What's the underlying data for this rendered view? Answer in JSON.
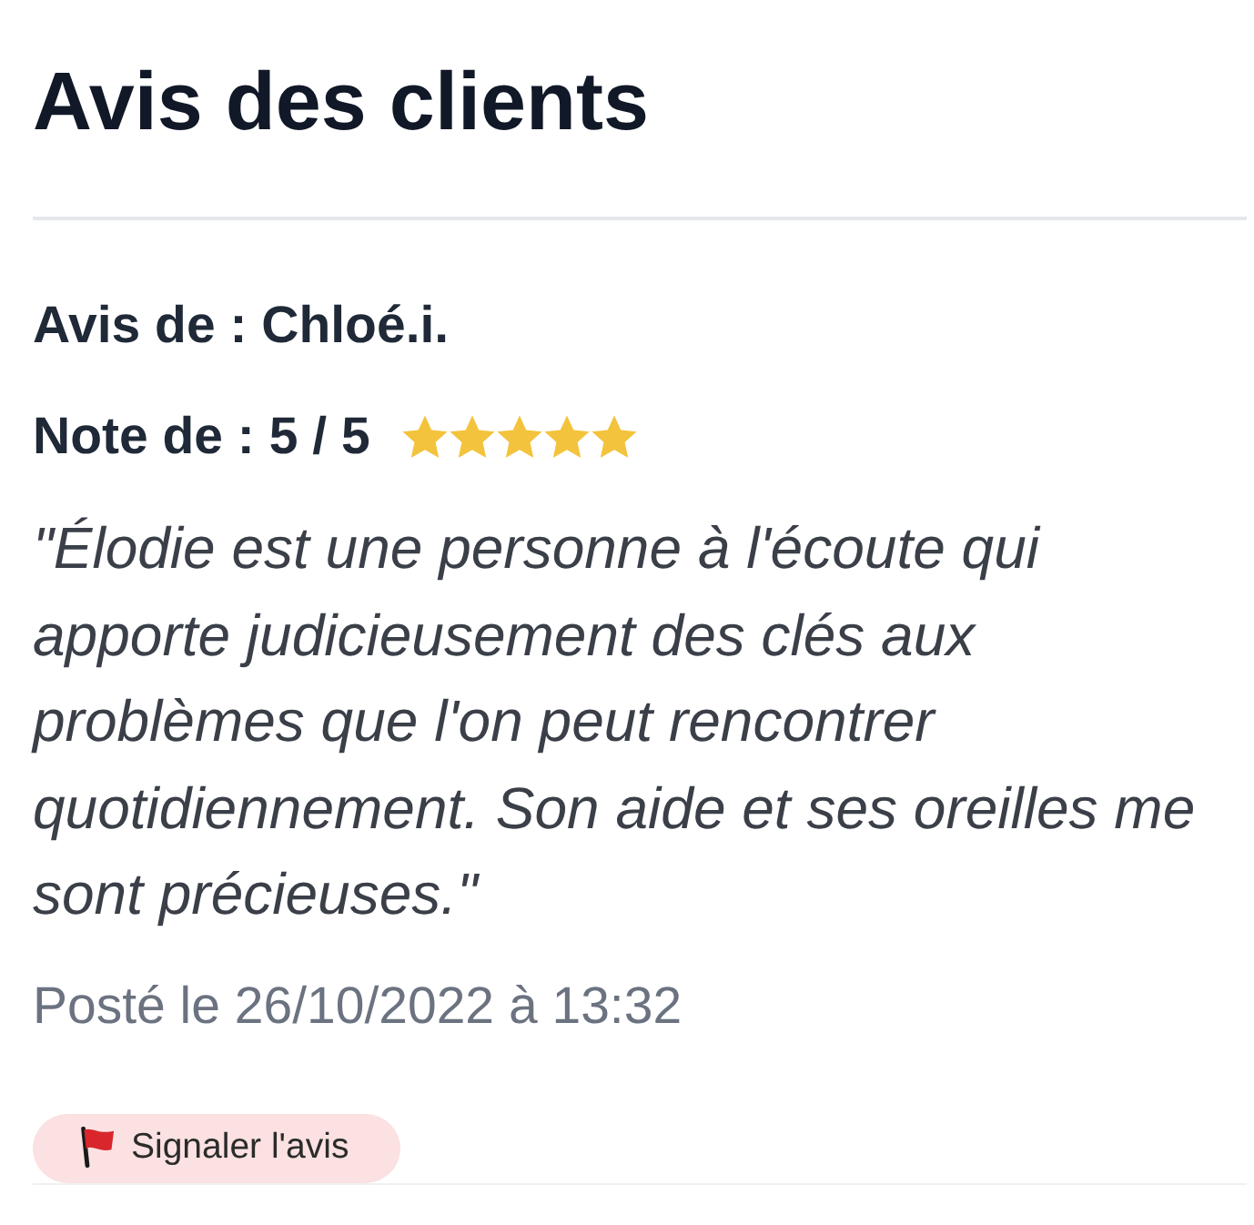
{
  "title": "Avis des clients",
  "review": {
    "author": "Avis de : Chloé.i.",
    "rating": "Note de : 5 / 5",
    "stars": 5,
    "text": "\"Élodie est une personne à l'écoute qui apporte judicieusement des clés aux problèmes que l'on peut rencontrer quotidiennement. Son aide et ses oreilles me sont précieuses.\"",
    "posted": "Posté le 26/10/2022 à 13:32",
    "report_button": "Signaler l'avis"
  }
}
